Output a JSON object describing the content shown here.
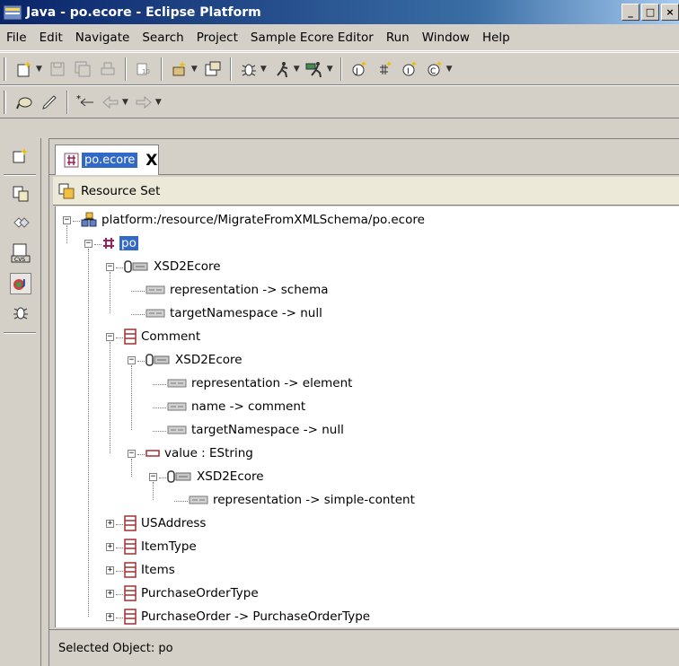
{
  "window": {
    "title": "Java - po.ecore - Eclipse Platform",
    "min_glyph": "_",
    "max_glyph": "□",
    "close_glyph": "×"
  },
  "menu": [
    "File",
    "Edit",
    "Navigate",
    "Search",
    "Project",
    "Sample Ecore Editor",
    "Run",
    "Window",
    "Help"
  ],
  "toolbar": {
    "row1": [
      "new-wizard-icon",
      "save-icon",
      "save-all-icon",
      "print-icon",
      "open-type-icon",
      "new-java-project-icon",
      "open-perspective-icon",
      "debug-icon",
      "run-icon",
      "external-tools-icon",
      "new-class-icon",
      "new-package-icon",
      "new-interface-icon",
      "new-enum-icon"
    ],
    "row2": [
      "search-icon",
      "pen-icon",
      "last-edit-icon",
      "back-icon",
      "forward-icon"
    ]
  },
  "shortcuts": [
    "open-perspective-icon",
    "resource-perspective-icon",
    "team-sync-icon",
    "cvs-icon",
    "java-perspective-icon",
    "debug-perspective-icon"
  ],
  "editor": {
    "tab_label": "po.ecore",
    "tab_close": "X",
    "header_label": "Resource Set",
    "status": "Selected Object: po"
  },
  "tree": [
    {
      "label": "platform:/resource/MigrateFromXMLSchema/po.ecore",
      "icon": "resource"
    },
    {
      "label": "po",
      "icon": "package"
    },
    {
      "label": "XSD2Ecore",
      "icon": "annotation"
    },
    {
      "label": "representation -> schema",
      "icon": "entry"
    },
    {
      "label": "targetNamespace -> null",
      "icon": "entry"
    },
    {
      "label": "Comment",
      "icon": "class"
    },
    {
      "label": "XSD2Ecore",
      "icon": "annotation"
    },
    {
      "label": "representation -> element",
      "icon": "entry"
    },
    {
      "label": "name -> comment",
      "icon": "entry"
    },
    {
      "label": "targetNamespace -> null",
      "icon": "entry"
    },
    {
      "label": "value : EString",
      "icon": "attribute"
    },
    {
      "label": "XSD2Ecore",
      "icon": "annotation"
    },
    {
      "label": "representation -> simple-content",
      "icon": "entry"
    },
    {
      "label": "USAddress",
      "icon": "class"
    },
    {
      "label": "ItemType",
      "icon": "class"
    },
    {
      "label": "Items",
      "icon": "class"
    },
    {
      "label": "PurchaseOrderType",
      "icon": "class"
    },
    {
      "label": "PurchaseOrder -> PurchaseOrderType",
      "icon": "class"
    }
  ],
  "colors": {
    "selection": "#3169c6",
    "title_bar": "#0a246a",
    "chrome": "#d4d0c8"
  }
}
